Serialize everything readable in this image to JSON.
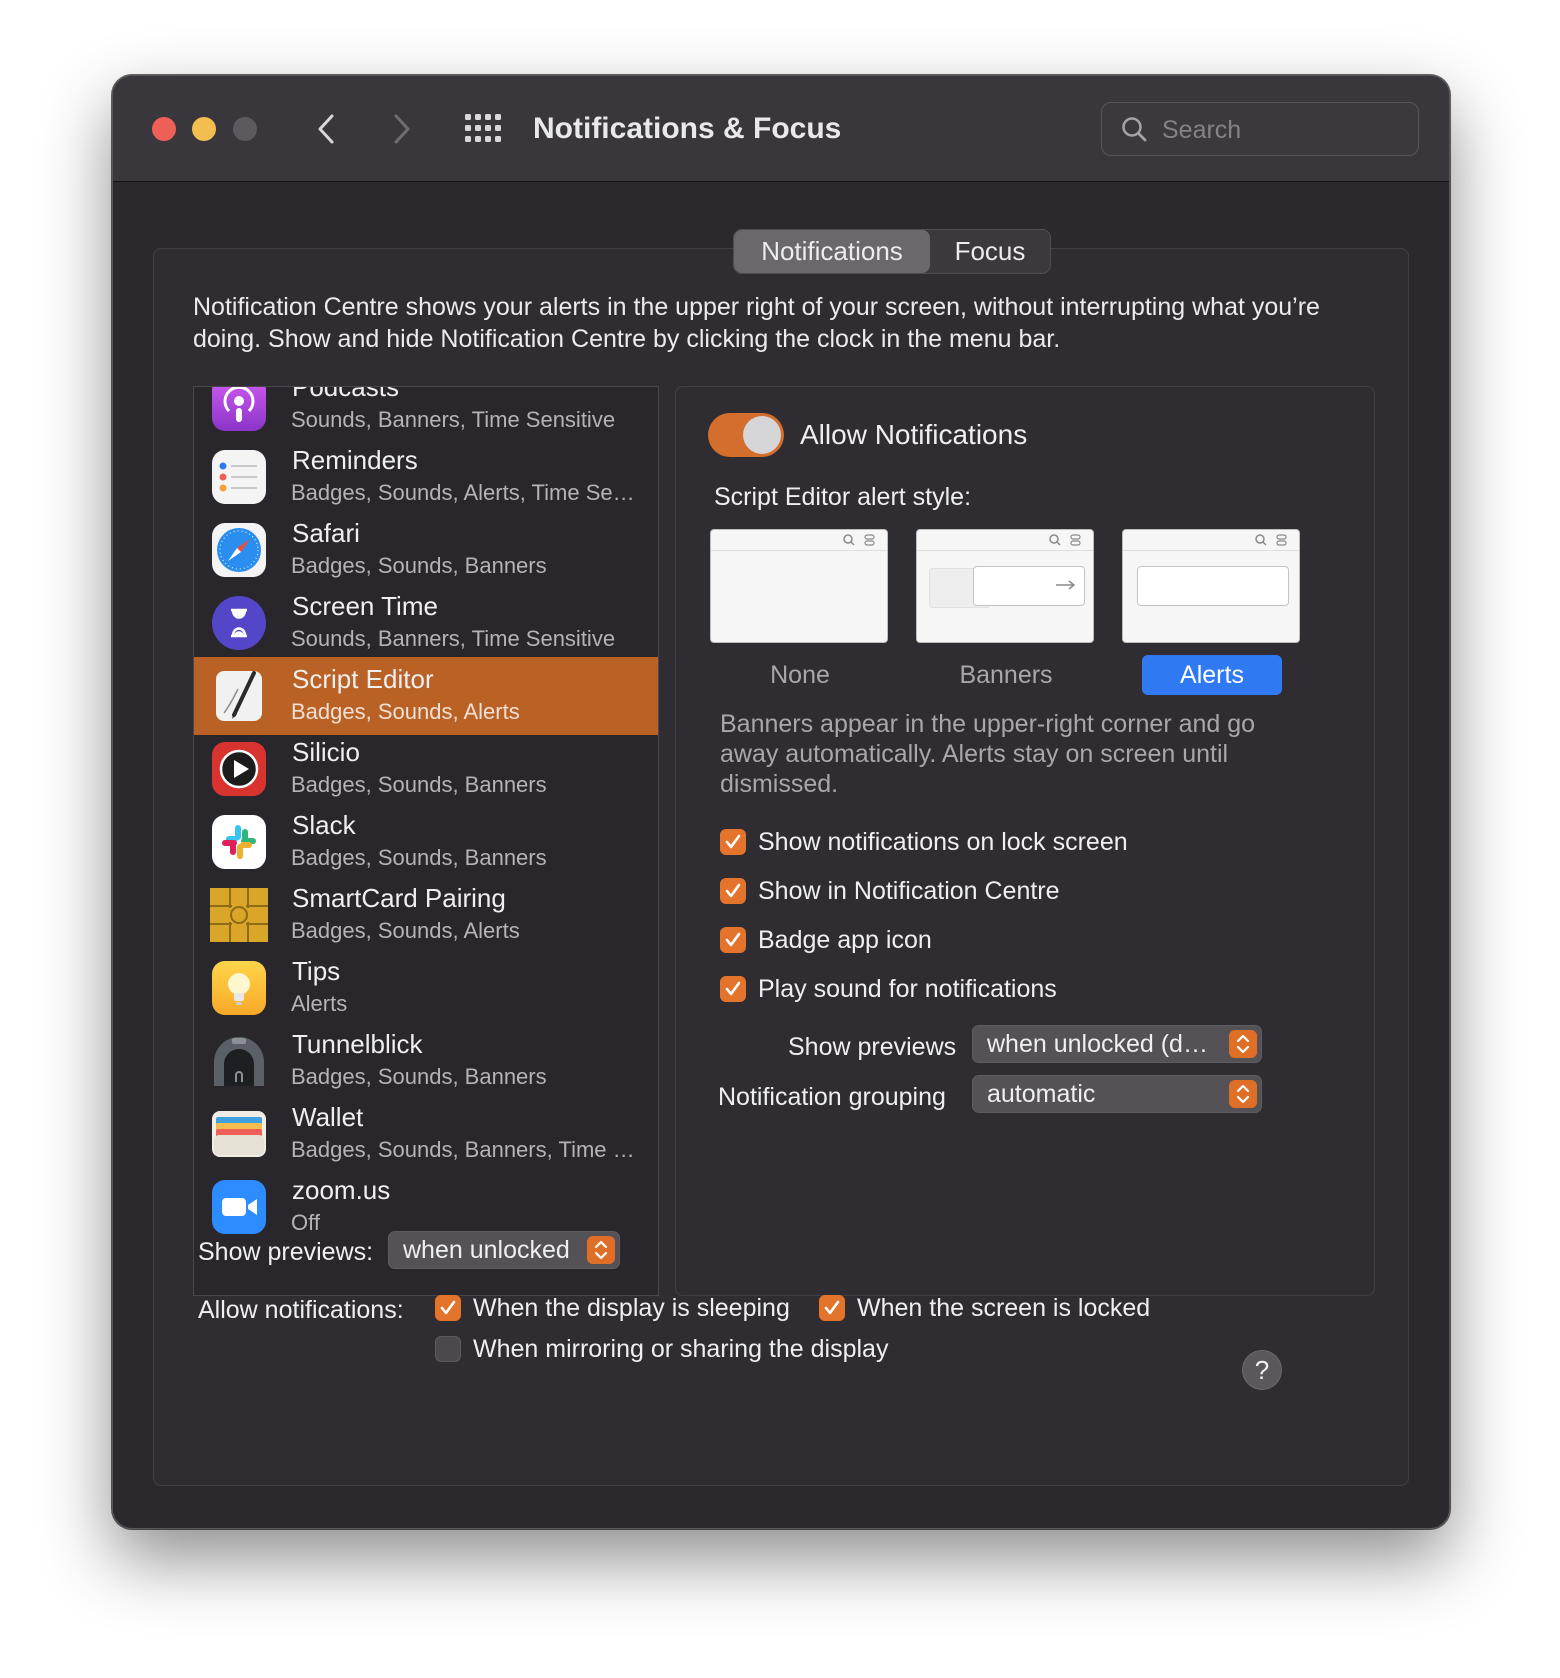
{
  "window": {
    "title": "Notifications & Focus",
    "search_placeholder": "Search"
  },
  "tabs": [
    {
      "label": "Notifications",
      "active": true
    },
    {
      "label": "Focus",
      "active": false
    }
  ],
  "intro_text": "Notification Centre shows your alerts in the upper right of your screen, without interrupting what you’re doing. Show and hide Notification Centre by clicking the clock in the menu bar.",
  "apps": [
    {
      "name": "Podcasts",
      "sub": "Sounds, Banners, Time Sensitive",
      "icon": "podcasts-icon",
      "selected": false
    },
    {
      "name": "Reminders",
      "sub": "Badges, Sounds, Alerts, Time Sensitive",
      "icon": "reminders-icon",
      "selected": false
    },
    {
      "name": "Safari",
      "sub": "Badges, Sounds, Banners",
      "icon": "safari-icon",
      "selected": false
    },
    {
      "name": "Screen Time",
      "sub": "Sounds, Banners, Time Sensitive",
      "icon": "screen-time-icon",
      "selected": false
    },
    {
      "name": "Script Editor",
      "sub": "Badges, Sounds, Alerts",
      "icon": "script-editor-icon",
      "selected": true
    },
    {
      "name": "Silicio",
      "sub": "Badges, Sounds, Banners",
      "icon": "silicio-icon",
      "selected": false
    },
    {
      "name": "Slack",
      "sub": "Badges, Sounds, Banners",
      "icon": "slack-icon",
      "selected": false
    },
    {
      "name": "SmartCard Pairing",
      "sub": "Badges, Sounds, Alerts",
      "icon": "smartcard-icon",
      "selected": false
    },
    {
      "name": "Tips",
      "sub": "Alerts",
      "icon": "tips-icon",
      "selected": false
    },
    {
      "name": "Tunnelblick",
      "sub": "Badges, Sounds, Banners",
      "icon": "tunnelblick-icon",
      "selected": false
    },
    {
      "name": "Wallet",
      "sub": "Badges, Sounds, Banners, Time Sensitive",
      "icon": "wallet-icon",
      "selected": false
    },
    {
      "name": "zoom.us",
      "sub": "Off",
      "icon": "zoom-icon",
      "selected": false
    }
  ],
  "detail": {
    "allow_label": "Allow Notifications",
    "allow_on": true,
    "style_label": "Script Editor alert style:",
    "styles": [
      {
        "label": "None",
        "selected": false
      },
      {
        "label": "Banners",
        "selected": false
      },
      {
        "label": "Alerts",
        "selected": true
      }
    ],
    "style_desc": "Banners appear in the upper-right corner and go away automatically. Alerts stay on screen until dismissed.",
    "checks": [
      {
        "label": "Show notifications on lock screen",
        "checked": true
      },
      {
        "label": "Show in Notification Centre",
        "checked": true
      },
      {
        "label": "Badge app icon",
        "checked": true
      },
      {
        "label": "Play sound for notifications",
        "checked": true
      }
    ],
    "show_previews_label": "Show previews",
    "show_previews_value": "when unlocked (default)",
    "grouping_label": "Notification grouping",
    "grouping_value": "automatic"
  },
  "global": {
    "show_previews_label": "Show previews:",
    "show_previews_value": "when unlocked",
    "allow_label": "Allow notifications:",
    "options": [
      {
        "label": "When the display is sleeping",
        "checked": true
      },
      {
        "label": "When the screen is locked",
        "checked": true
      },
      {
        "label": "When mirroring or sharing the display",
        "checked": false
      }
    ]
  },
  "help_label": "?",
  "colors": {
    "accent": "#e4742b",
    "selection": "#ba6226",
    "selected_style": "#2f7af3",
    "window_bg": "#2b282e"
  }
}
